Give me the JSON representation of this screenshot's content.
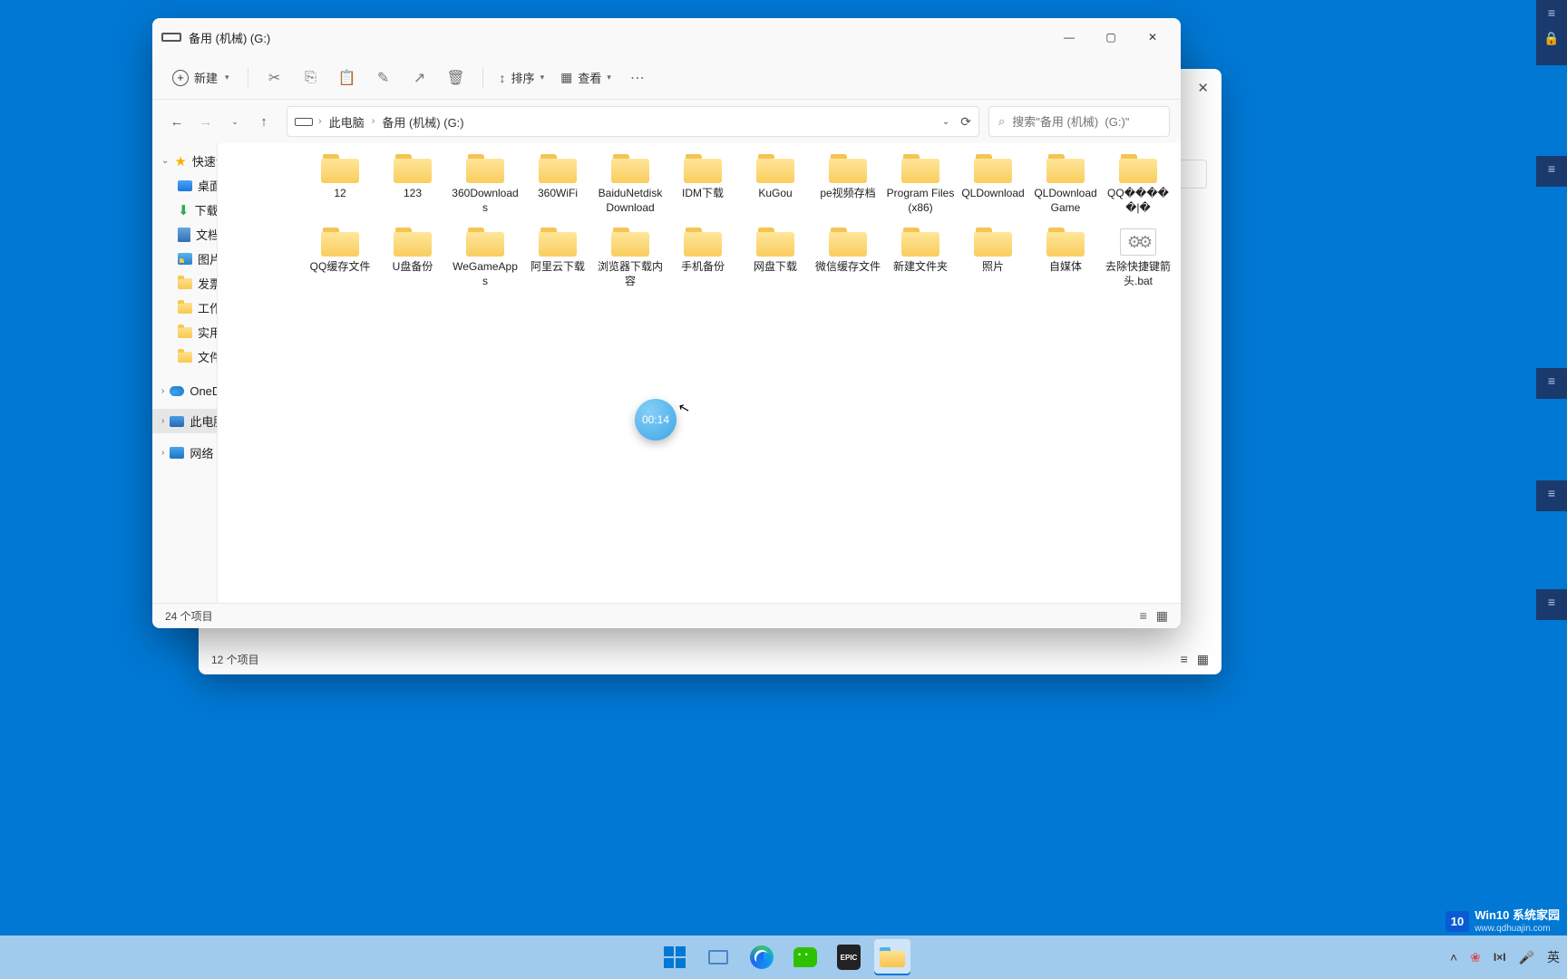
{
  "window": {
    "title": "备用 (机械)  (G:)",
    "toolbar": {
      "new_label": "新建",
      "sort_label": "排序",
      "view_label": "查看"
    },
    "breadcrumb": [
      "此电脑",
      "备用 (机械)  (G:)"
    ],
    "search_placeholder": "搜索\"备用 (机械)  (G:)\"",
    "status": "24 个项目"
  },
  "sidebar": {
    "quick_access": "快速访问",
    "pinned": [
      {
        "label": "桌面",
        "icon": "desktop"
      },
      {
        "label": "下载",
        "icon": "download"
      },
      {
        "label": "文档",
        "icon": "doc"
      },
      {
        "label": "图片",
        "icon": "pic"
      }
    ],
    "folders": [
      {
        "label": "发票"
      },
      {
        "label": "工作总结及书面材料"
      },
      {
        "label": "实用工具"
      },
      {
        "label": "文件"
      }
    ],
    "onedrive": "OneDrive - Personal",
    "this_pc": "此电脑",
    "network": "网络"
  },
  "items_row1": [
    {
      "name": "12",
      "type": "folder"
    },
    {
      "name": "123",
      "type": "folder"
    },
    {
      "name": "360Downloads",
      "type": "folder"
    },
    {
      "name": "360WiFi",
      "type": "folder"
    },
    {
      "name": "BaiduNetdiskDownload",
      "type": "folder"
    },
    {
      "name": "IDM下载",
      "type": "folder"
    },
    {
      "name": "KuGou",
      "type": "folder"
    },
    {
      "name": "pe视频存档",
      "type": "folder"
    },
    {
      "name": "Program Files (x86)",
      "type": "folder"
    },
    {
      "name": "QLDownload",
      "type": "folder"
    },
    {
      "name": "QLDownloadGame",
      "type": "folder"
    },
    {
      "name": "QQ�����|�",
      "type": "folder"
    }
  ],
  "items_row2": [
    {
      "name": "QQ缓存文件",
      "type": "folder"
    },
    {
      "name": "U盘备份",
      "type": "folder"
    },
    {
      "name": "WeGameApps",
      "type": "folder"
    },
    {
      "name": "阿里云下载",
      "type": "folder"
    },
    {
      "name": "浏览器下载内容",
      "type": "folder"
    },
    {
      "name": "手机备份",
      "type": "folder"
    },
    {
      "name": "网盘下载",
      "type": "folder"
    },
    {
      "name": "微信缓存文件",
      "type": "folder"
    },
    {
      "name": "新建文件夹",
      "type": "folder"
    },
    {
      "name": "照片",
      "type": "folder"
    },
    {
      "name": "自媒体",
      "type": "folder"
    },
    {
      "name": "去除快捷键箭头.bat",
      "type": "bat"
    }
  ],
  "timer": "00:14",
  "back_window": {
    "status": "12 个项目"
  },
  "taskbar": {
    "ime_lang": "英",
    "epic_text": "EPIC"
  },
  "watermark": {
    "brand1": "10",
    "brand2": "Win10",
    "brand3": "系统家园",
    "url": "www.qdhuajin.com"
  }
}
